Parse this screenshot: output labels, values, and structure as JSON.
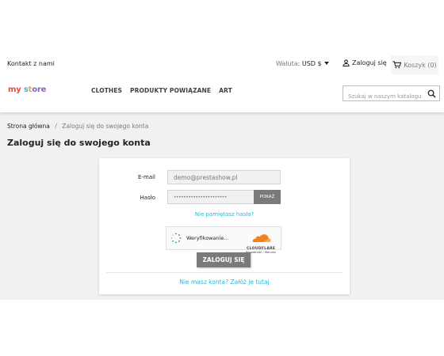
{
  "topbar": {
    "contact": "Kontakt z nami",
    "currency_label": "Waluta:",
    "currency_value": "USD $",
    "signin": "Zaloguj się",
    "cart": "Koszyk (0)"
  },
  "header": {
    "logo": [
      "my",
      " ",
      "s",
      "t",
      "ore"
    ],
    "menu": [
      "CLOTHES",
      "PRODUKTY POWIĄZANE",
      "ART"
    ],
    "search_placeholder": "Szukaj w naszym katalogu"
  },
  "breadcrumb": {
    "home": "Strona główna",
    "separator": "/",
    "current": "Zaloguj się do swojego konta"
  },
  "page_title": "Zaloguj się do swojego konta",
  "form": {
    "email_label": "E-mail",
    "email_value": "demo@prestashow.pl",
    "password_label": "Hasło",
    "password_value": "••••••••••••••••••••••",
    "show_label": "POKAŻ",
    "forgot": "Nie pamiętasz hasła?",
    "captcha_status": "Weryfikowanie...",
    "captcha_brand": "CLOUDFLARE",
    "captcha_links": "Prywatność / Warunki",
    "submit": "ZALOGUJ SIĘ",
    "register": "Nie masz konta? Załóż je tutaj"
  },
  "colors": {
    "accent": "#24b9d7",
    "button": "#7a7a7a",
    "background": "#f1f1f1",
    "cloudflare": "#f38020"
  }
}
